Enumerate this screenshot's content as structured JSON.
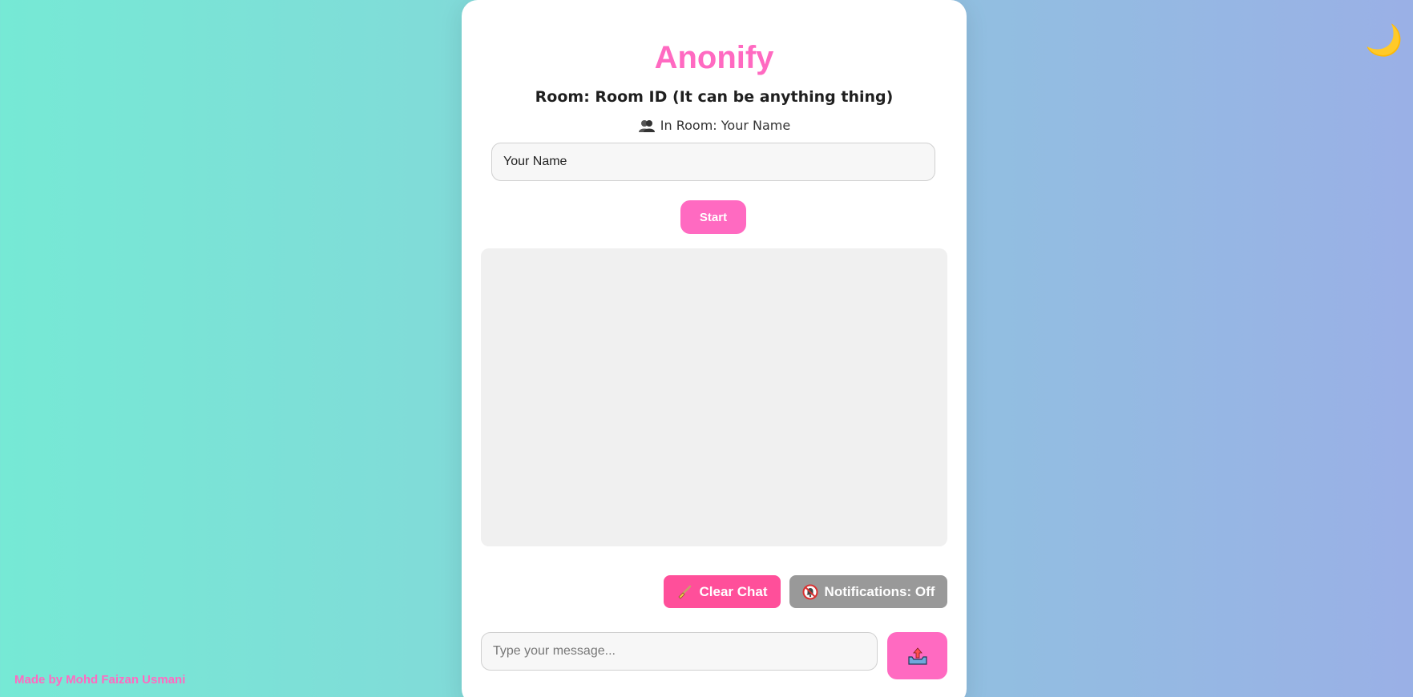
{
  "theme_toggle": {
    "icon": "moon-icon",
    "glyph": "🌙"
  },
  "credit": {
    "text": "Made by Mohd Faizan Usmani"
  },
  "card": {
    "title": "Anonify",
    "room_line": "Room: Room ID (It can be anything thing)",
    "in_room": {
      "icon": "users-icon",
      "text": "In Room: Your Name"
    },
    "name_input": {
      "value": "Your Name",
      "placeholder": "Your Name"
    },
    "start_label": "Start",
    "clear_chat": {
      "icon": "broom-icon",
      "label": "Clear Chat"
    },
    "notifications": {
      "icon": "bell-off-icon",
      "label": "Notifications: Off"
    },
    "message_input": {
      "value": "",
      "placeholder": "Type your message..."
    },
    "send": {
      "icon": "outbox-tray-icon"
    }
  },
  "colors": {
    "accent": "#ff6ac1",
    "clear_button": "#ff4f9a",
    "notifications_off": "#999999"
  }
}
